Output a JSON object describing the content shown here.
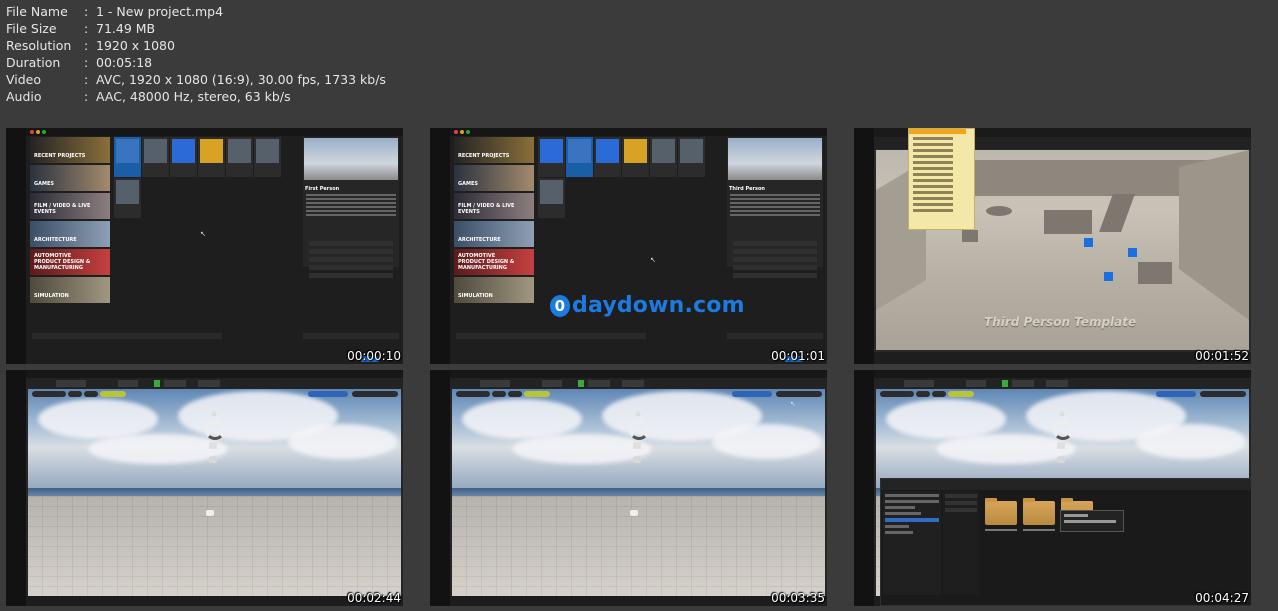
{
  "file_info": [
    {
      "key": "File Name",
      "value": "1 - New project.mp4"
    },
    {
      "key": "File Size",
      "value": "71.49 MB"
    },
    {
      "key": "Resolution",
      "value": "1920 x 1080"
    },
    {
      "key": "Duration",
      "value": "00:05:18"
    },
    {
      "key": "Video",
      "value": "AVC, 1920 x 1080 (16:9), 30.00 fps, 1733 kb/s"
    },
    {
      "key": "Audio",
      "value": "AAC, 48000 Hz, stereo, 63 kb/s"
    }
  ],
  "separator": ":",
  "watermark": {
    "text": "daydown.com",
    "icon_glyph": "0",
    "color": "#1c7be0"
  },
  "project_browser": {
    "categories": [
      "RECENT PROJECTS",
      "GAMES",
      "FILM / VIDEO & LIVE EVENTS",
      "ARCHITECTURE",
      "AUTOMOTIVE PRODUCT DESIGN & MANUFACTURING",
      "SIMULATION"
    ],
    "description_title_1": "First Person",
    "description_title_2": "Third Person"
  },
  "template_viewport": {
    "overlay_text": "Third Person Template"
  },
  "thumbnails": [
    {
      "timestamp": "00:00:10"
    },
    {
      "timestamp": "00:01:01"
    },
    {
      "timestamp": "00:01:52"
    },
    {
      "timestamp": "00:02:44"
    },
    {
      "timestamp": "00:03:35"
    },
    {
      "timestamp": "00:04:27"
    }
  ],
  "colors": {
    "background": "#3b3b3b",
    "accent_blue": "#1c68c7",
    "menu_highlight": "#f5a41a",
    "play_green": "#3eaa3e"
  }
}
